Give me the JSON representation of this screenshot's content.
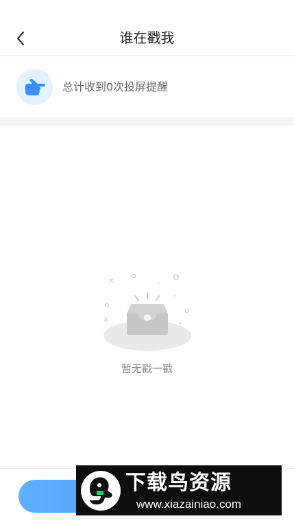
{
  "navbar": {
    "title": "谁在戳我",
    "back_icon": "chevron-left-icon"
  },
  "summary": {
    "icon": "pointing-hand-icon",
    "text": "总计收到0次投屏提醒",
    "count": 0
  },
  "empty_state": {
    "illustration": "empty-inbox-icon",
    "text": "暂无戳一戳"
  },
  "bottom_button": {
    "label": ""
  },
  "watermark": {
    "title": "下载鸟资源",
    "url": "www.xiazainiao.com"
  },
  "colors": {
    "accent": "#3b8dff",
    "icon_bg": "#e4f1ff",
    "text_primary": "#222222",
    "text_secondary": "#666666",
    "text_muted": "#8a8a8a",
    "divider": "#f5f5f5"
  }
}
